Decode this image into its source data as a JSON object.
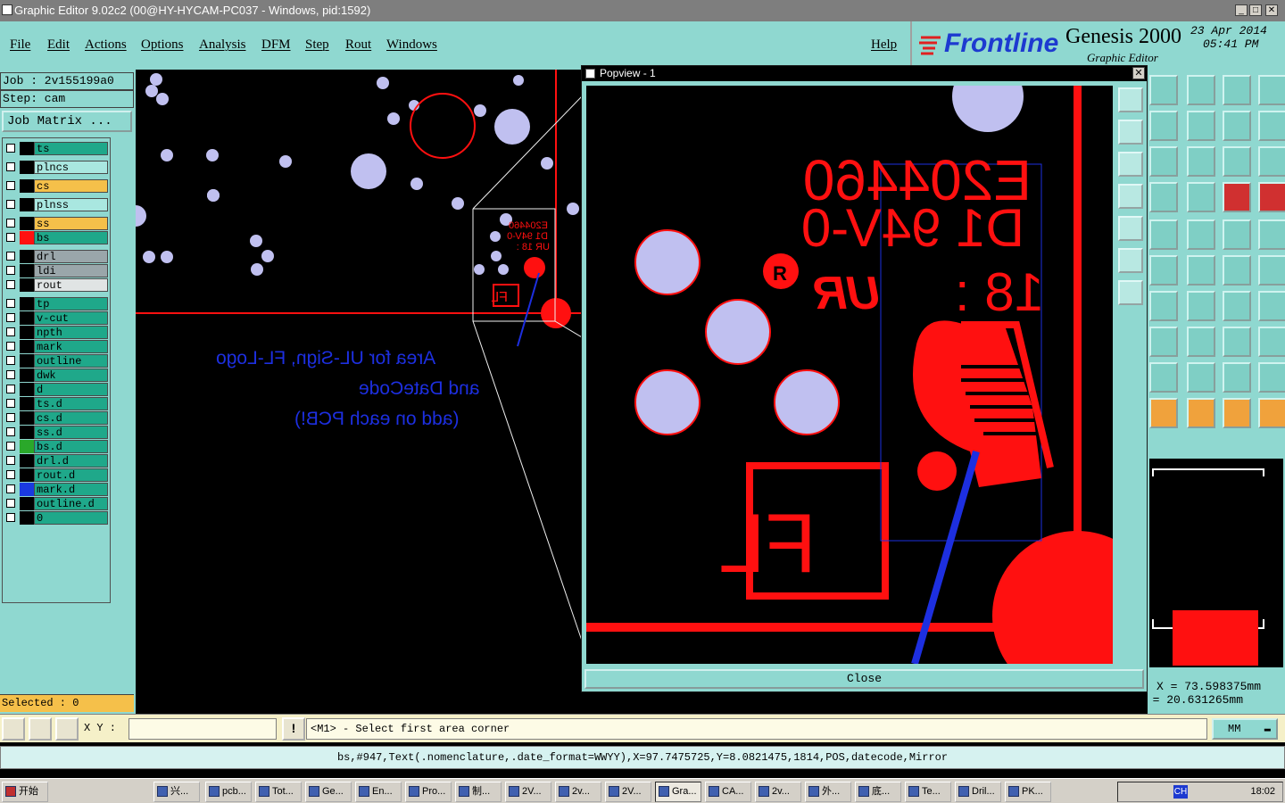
{
  "window": {
    "title": "Graphic Editor 9.02c2 (00@HY-HYCAM-PC037 - Windows, pid:1592)",
    "minimize": "_",
    "maximize": "□",
    "close": "✕"
  },
  "menu": {
    "items": [
      "File",
      "Edit",
      "Actions",
      "Options",
      "Analysis",
      "DFM",
      "Step",
      "Rout",
      "Windows"
    ],
    "help": "Help"
  },
  "brand": {
    "logo": "Frontline",
    "product": "Genesis 2000",
    "subtitle": "Graphic Editor",
    "date": "23 Apr 2014",
    "time": "05:41 PM"
  },
  "left": {
    "job": "Job : 2v155199a0",
    "step": "Step: cam",
    "job_matrix": "Job Matrix ...",
    "selected": "Selected : 0",
    "layers": [
      {
        "name": "ts",
        "bg": "#1fa88a",
        "swatch": "#000000"
      },
      {
        "name": "plncs",
        "bg": "#a9e7e0",
        "swatch": "#000000"
      },
      {
        "name": "cs",
        "bg": "#f5c04a",
        "swatch": "#000000"
      },
      {
        "name": "plnss",
        "bg": "#a9e7e0",
        "swatch": "#000000"
      },
      {
        "name": "ss",
        "bg": "#f5c04a",
        "swatch": "#000000"
      },
      {
        "name": "bs",
        "bg": "#1fa88a",
        "swatch": "#ff1010"
      },
      {
        "name": "drl",
        "bg": "#9aa6aa",
        "swatch": "#000000"
      },
      {
        "name": "ldi",
        "bg": "#9aa6aa",
        "swatch": "#000000"
      },
      {
        "name": "rout",
        "bg": "#e0e4e4",
        "swatch": "#000000"
      },
      {
        "name": "tp",
        "bg": "#1fa88a",
        "swatch": "#000000"
      },
      {
        "name": "v-cut",
        "bg": "#1fa88a",
        "swatch": "#000000"
      },
      {
        "name": "npth",
        "bg": "#1fa88a",
        "swatch": "#000000"
      },
      {
        "name": "mark",
        "bg": "#1fa88a",
        "swatch": "#000000"
      },
      {
        "name": "outline",
        "bg": "#1fa88a",
        "swatch": "#000000"
      },
      {
        "name": "dwk",
        "bg": "#1fa88a",
        "swatch": "#000000"
      },
      {
        "name": "d",
        "bg": "#1fa88a",
        "swatch": "#000000"
      },
      {
        "name": "ts.d",
        "bg": "#1fa88a",
        "swatch": "#000000"
      },
      {
        "name": "cs.d",
        "bg": "#1fa88a",
        "swatch": "#000000"
      },
      {
        "name": "ss.d",
        "bg": "#1fa88a",
        "swatch": "#000000"
      },
      {
        "name": "bs.d",
        "bg": "#1fa88a",
        "swatch": "#2aa82a"
      },
      {
        "name": "drl.d",
        "bg": "#1fa88a",
        "swatch": "#000000"
      },
      {
        "name": "rout.d",
        "bg": "#1fa88a",
        "swatch": "#000000"
      },
      {
        "name": "mark.d",
        "bg": "#1fa88a",
        "swatch": "#1a3ae0"
      },
      {
        "name": "outline.d",
        "bg": "#1fa88a",
        "swatch": "#000000"
      },
      {
        "name": "0",
        "bg": "#1fa88a",
        "swatch": "#000000"
      }
    ]
  },
  "canvas": {
    "annotation_lines": [
      "Area for UL-Sign, FL-Logo",
      "and DateCode",
      "(add on each PCB!)"
    ],
    "mini_text1": "E204460",
    "mini_text2": "D1 94V-0",
    "mini_text3": "UR 18 :",
    "mini_logo": "FL"
  },
  "popview": {
    "title": "Popview - 1",
    "close_x": "✕",
    "close_label": "Close",
    "text1": "E204460",
    "text2": "D1 94V-0",
    "text3": "18 :",
    "ul_mark": "UR",
    "ul_c": "R",
    "logo": "FL"
  },
  "coords": {
    "x": "X = 73.598375mm",
    "y": "Y = 20.631265mm"
  },
  "command": {
    "xy_label": "X Y :",
    "alert": "!",
    "message": "<M1> - Select first area corner",
    "units": "MM",
    "units_arrow": "▬"
  },
  "status": {
    "text": "bs,#947,Text(.nomenclature,.date_format=WWYY),X=97.7475725,Y=8.0821475,1814,POS,datecode,Mirror"
  },
  "taskbar": {
    "start": "开始",
    "tasks": [
      "兴...",
      "pcb...",
      "Tot...",
      "Ge...",
      "En...",
      "Pro...",
      "制...",
      "2V...",
      "2v...",
      "2V...",
      "Gra...",
      "CA...",
      "2v...",
      "外...",
      "底...",
      "Te...",
      "Dril...",
      "PK..."
    ],
    "clock": "18:02",
    "lang": "CH"
  },
  "colors": {
    "panel": "#8fd8d0",
    "board_red": "#ff0a0a",
    "pad_lilac": "#c0c0f0",
    "annotation_blue": "#1d2fe0"
  }
}
